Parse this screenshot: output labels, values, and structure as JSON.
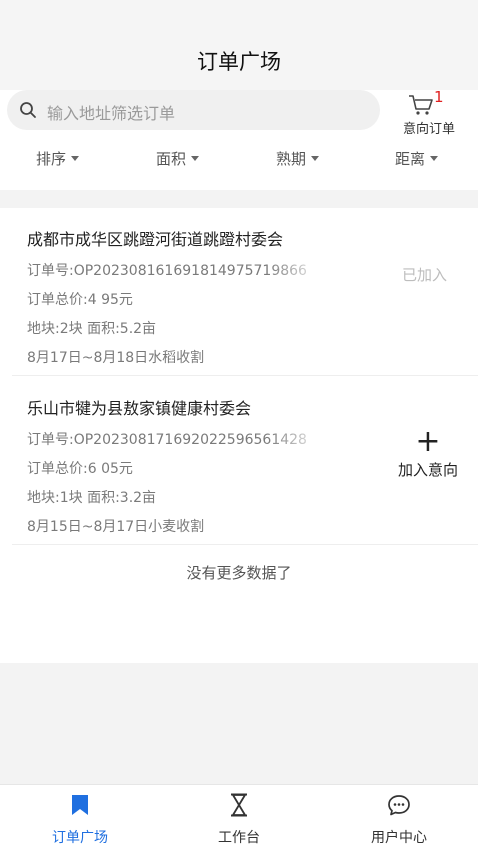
{
  "header": {
    "title": "订单广场"
  },
  "search": {
    "placeholder": "输入地址筛选订单",
    "icon": "search-icon"
  },
  "intent": {
    "badge": "1",
    "label": "意向订单",
    "icon": "cart-icon",
    "badge_color": "#e02020"
  },
  "filters": [
    {
      "label": "排序"
    },
    {
      "label": "面积"
    },
    {
      "label": "熟期"
    },
    {
      "label": "距离"
    }
  ],
  "orders": [
    {
      "name": "成都市成华区跳蹬河街道跳蹬村委会",
      "order_no": "订单号:OP202308161691814975719866",
      "total": "订单总价:4 95元",
      "plot": "地块:2块 面积:5.2亩",
      "harvest": "8月17日~8月18日水稻收割",
      "status": "已加入"
    },
    {
      "name": "乐山市犍为县敖家镇健康村委会",
      "order_no": "订单号:OP202308171692022596561428",
      "total": "订单总价:6 05元",
      "plot": "地块:1块 面积:3.2亩",
      "harvest": "8月15日~8月17日小麦收割",
      "action_label": "加入意向"
    }
  ],
  "list_footer": "没有更多数据了",
  "tabbar": [
    {
      "label": "订单广场",
      "icon": "bookmark-icon",
      "active": true
    },
    {
      "label": "工作台",
      "icon": "hourglass-icon",
      "active": false
    },
    {
      "label": "用户中心",
      "icon": "chat-bubble-icon",
      "active": false
    }
  ],
  "colors": {
    "accent": "#1f6fe0",
    "badge": "#e02020"
  }
}
